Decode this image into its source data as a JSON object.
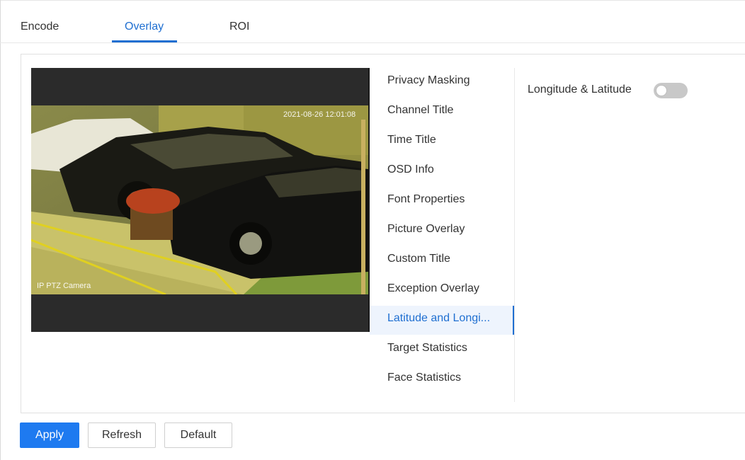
{
  "tabs": [
    {
      "label": "Encode",
      "active": false
    },
    {
      "label": "Overlay",
      "active": true
    },
    {
      "label": "ROI",
      "active": false
    }
  ],
  "preview": {
    "timestamp_overlay": "2021-08-26 12:01:08",
    "channel_overlay": "IP PTZ Camera"
  },
  "menu": {
    "items": [
      {
        "label": "Privacy Masking"
      },
      {
        "label": "Channel Title"
      },
      {
        "label": "Time Title"
      },
      {
        "label": "OSD Info"
      },
      {
        "label": "Font Properties"
      },
      {
        "label": "Picture Overlay"
      },
      {
        "label": "Custom Title"
      },
      {
        "label": "Exception Overlay"
      },
      {
        "label": "Latitude and Longi..."
      },
      {
        "label": "Target Statistics"
      },
      {
        "label": "Face Statistics"
      }
    ],
    "active_index": 8
  },
  "setting": {
    "label": "Longitude & Latitude",
    "enabled": false
  },
  "buttons": {
    "apply": "Apply",
    "refresh": "Refresh",
    "default": "Default"
  },
  "colors": {
    "accent": "#1f6fd1",
    "primary_button": "#1e7af0",
    "toggle_off": "#c8c8c8"
  }
}
